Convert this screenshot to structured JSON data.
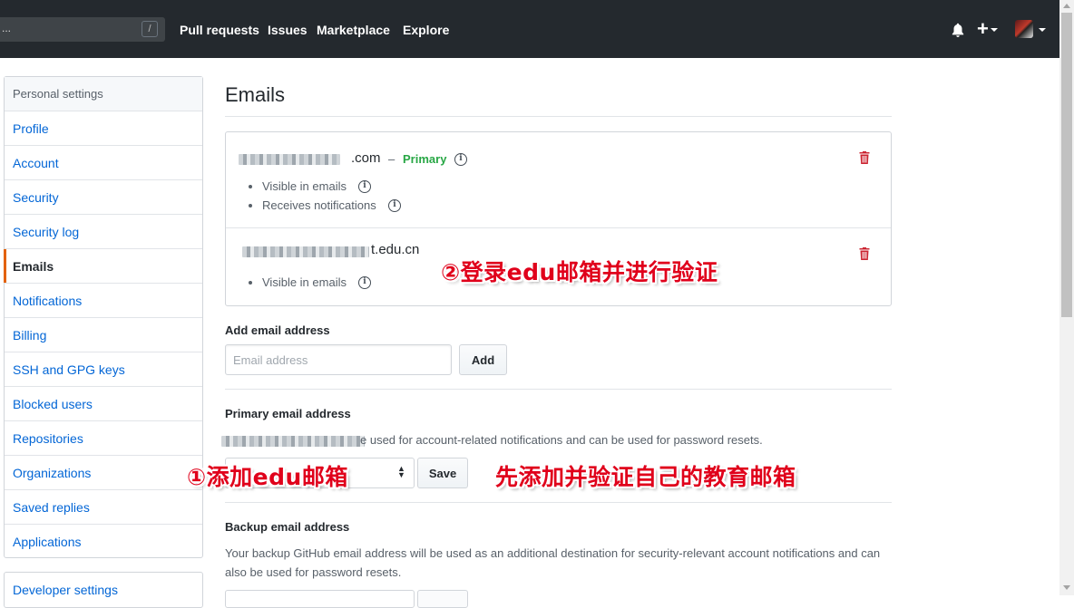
{
  "header": {
    "search_prefix": "...",
    "search_shortcut": "/",
    "nav": [
      "Pull requests",
      "Issues",
      "Marketplace",
      "Explore"
    ],
    "plus_glyph": "+",
    "icons": [
      "bell-icon",
      "plus-icon",
      "avatar"
    ]
  },
  "sidebar": {
    "heading": "Personal settings",
    "items": [
      "Profile",
      "Account",
      "Security",
      "Security log",
      "Emails",
      "Notifications",
      "Billing",
      "SSH and GPG keys",
      "Blocked users",
      "Repositories",
      "Organizations",
      "Saved replies",
      "Applications"
    ],
    "selected": "Emails",
    "developer_settings": "Developer settings"
  },
  "main": {
    "title": "Emails",
    "emails": [
      {
        "address_tail": ".com",
        "dash": "–",
        "primary_label": "Primary",
        "bullets": [
          "Visible in emails",
          "Receives notifications"
        ]
      },
      {
        "address_tail": "t.edu.cn",
        "bullets": [
          "Visible in emails"
        ]
      }
    ],
    "add_email": {
      "label": "Add email address",
      "placeholder": "Email address",
      "button": "Add"
    },
    "primary_email": {
      "label": "Primary email address",
      "description_tail": "e used for account-related notifications and can be used for password resets.",
      "save_button": "Save"
    },
    "backup_email": {
      "label": "Backup email address",
      "description": "Your backup GitHub email address will be used as an additional destination for security-relevant account notifications and can also be used for password resets."
    }
  },
  "annotations": {
    "step1": "①添加edu邮箱",
    "step2": "②登录edu邮箱并进行验证",
    "note": "先添加并验证自己的教育邮箱"
  },
  "colors": {
    "header_bg": "#24292e",
    "link": "#0366d6",
    "primary_green": "#28a745",
    "trash_red": "#cb2431",
    "selected_accent": "#e36209",
    "annotation_red": "#e0001b"
  }
}
